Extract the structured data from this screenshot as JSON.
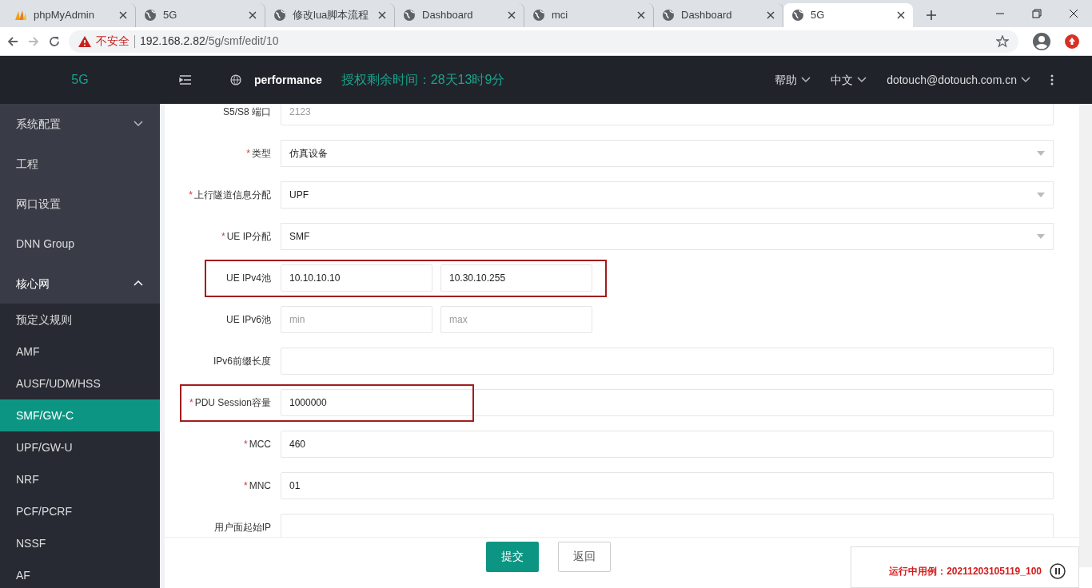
{
  "browser": {
    "tabs": [
      {
        "label": "phpMyAdmin",
        "selected": false
      },
      {
        "label": "5G",
        "selected": false
      },
      {
        "label": "修改lua脚本流程",
        "selected": false
      },
      {
        "label": "Dashboard",
        "selected": false
      },
      {
        "label": "mci",
        "selected": false
      },
      {
        "label": "Dashboard",
        "selected": false
      },
      {
        "label": "5G",
        "selected": true
      }
    ],
    "security": "不安全",
    "url_host": "192.168.2.82",
    "url_path": "/5g/smf/edit/10"
  },
  "header": {
    "brand": "5G",
    "project": "performance",
    "license": "授权剩余时间：28天13时9分",
    "menus": [
      "帮助",
      "中文",
      "dotouch@dotouch.com.cn"
    ]
  },
  "sidebar": {
    "items": [
      {
        "label": "系统配置",
        "expanded": false,
        "selected": false
      },
      {
        "label": "工程",
        "selected": false
      },
      {
        "label": "网口设置",
        "selected": false
      },
      {
        "label": "DNN Group",
        "selected": false
      },
      {
        "label": "核心网",
        "expanded": true,
        "selected": false,
        "children": [
          {
            "label": "预定义规则",
            "selected": false
          },
          {
            "label": "AMF",
            "selected": false
          },
          {
            "label": "AUSF/UDM/HSS",
            "selected": false
          },
          {
            "label": "SMF/GW-C",
            "selected": true
          },
          {
            "label": "UPF/GW-U",
            "selected": false
          },
          {
            "label": "NRF",
            "selected": false
          },
          {
            "label": "PCF/PCRF",
            "selected": false
          },
          {
            "label": "NSSF",
            "selected": false
          },
          {
            "label": "AF",
            "selected": false
          }
        ]
      }
    ]
  },
  "form": {
    "fields": [
      {
        "kind": "text",
        "label": "S5/S8 端口",
        "disabled": true,
        "highlighted": false,
        "value": "2123"
      },
      {
        "kind": "select",
        "required_mark": "*",
        "label": "类型",
        "highlighted": false,
        "value": "仿真设备"
      },
      {
        "kind": "select",
        "required_mark": "*",
        "label": "上行隧道信息分配",
        "highlighted": false,
        "value": "UPF"
      },
      {
        "kind": "select",
        "required_mark": "*",
        "label": "UE IP分配",
        "highlighted": false,
        "value": "SMF"
      },
      {
        "kind": "range",
        "label": "UE IPv4池",
        "highlighted": true,
        "from": {
          "value": "10.10.10.10"
        },
        "to": {
          "value": "10.30.10.255"
        }
      },
      {
        "kind": "range",
        "label": "UE IPv6池",
        "highlighted": false,
        "from": {
          "placeholder": "min"
        },
        "to": {
          "placeholder": "max"
        }
      },
      {
        "kind": "text",
        "label": "IPv6前缀长度",
        "disabled": false,
        "highlighted": false
      },
      {
        "kind": "text",
        "required_mark": "*",
        "label": "PDU Session容量",
        "disabled": false,
        "highlighted": true,
        "value": "1000000"
      },
      {
        "kind": "text",
        "required_mark": "*",
        "label": "MCC",
        "disabled": false,
        "highlighted": false,
        "value": "460"
      },
      {
        "kind": "text",
        "required_mark": "*",
        "label": "MNC",
        "disabled": false,
        "highlighted": false,
        "value": "01"
      },
      {
        "kind": "text",
        "label": "用户面起始IP",
        "disabled": false,
        "highlighted": false
      }
    ],
    "buttons": [
      {
        "label": "提交",
        "kind": "primary"
      },
      {
        "label": "返回",
        "kind": "secondary"
      }
    ]
  },
  "run_panel": {
    "text": "运行中用例：20211203105119_100"
  }
}
